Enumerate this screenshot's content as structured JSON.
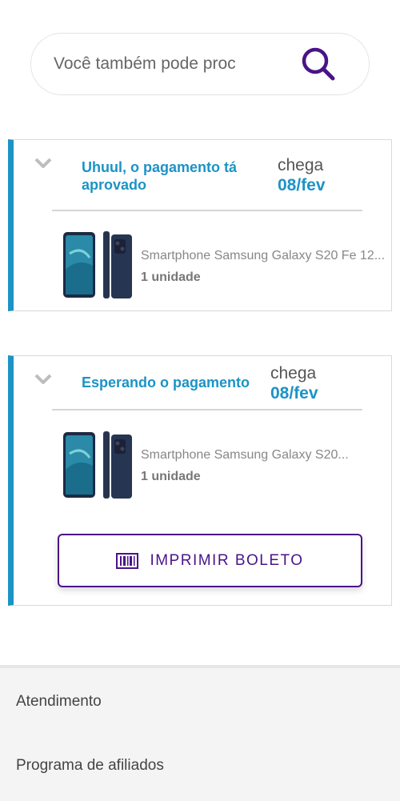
{
  "search": {
    "placeholder": "Você também pode proc"
  },
  "orders": [
    {
      "status": "Uhuul, o pagamento tá aprovado",
      "arrive_label": "chega",
      "arrive_date": "08/fev",
      "product_name": "Smartphone Samsung Galaxy S20 Fe 12...",
      "quantity": "1 unidade"
    },
    {
      "status": "Esperando o pagamento",
      "arrive_label": "chega",
      "arrive_date": "08/fev",
      "product_name": "Smartphone Samsung Galaxy S20...",
      "quantity": "1 unidade",
      "button_label": "IMPRIMIR BOLETO"
    }
  ],
  "footer": {
    "links": [
      "Atendimento",
      "Programa de afiliados"
    ]
  },
  "colors": {
    "accent": "#1c93c6",
    "brand_purple": "#4a1488"
  },
  "icons": {
    "search": "search-icon",
    "chevron": "chevron-down-icon",
    "barcode": "barcode-icon"
  }
}
